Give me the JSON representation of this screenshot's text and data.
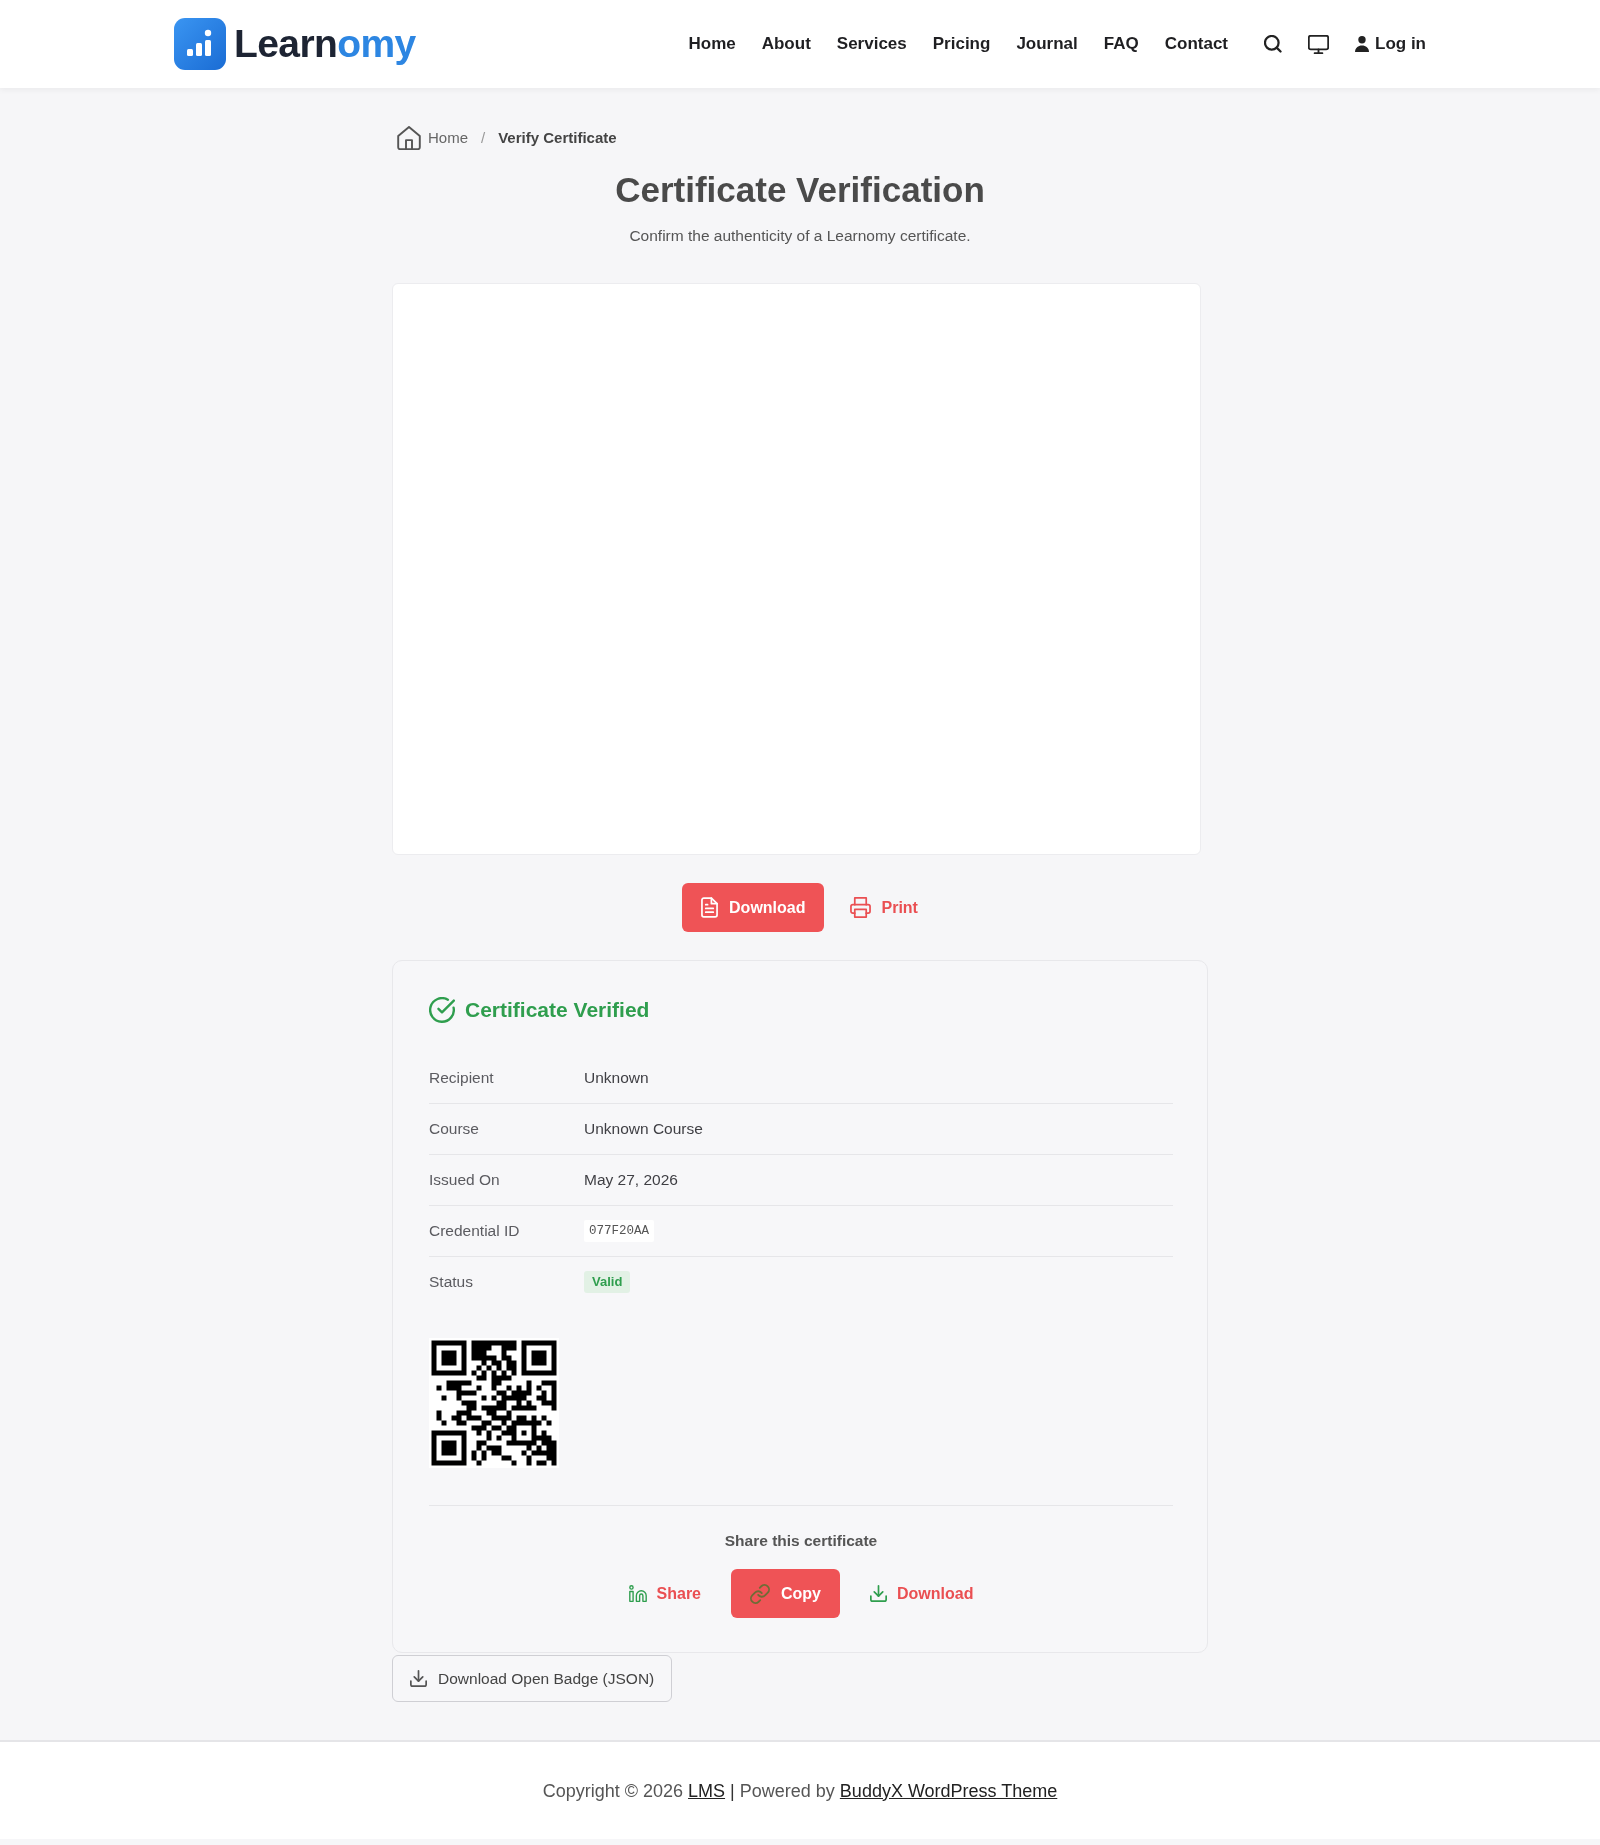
{
  "header": {
    "logo": {
      "main": "Learn",
      "accent": "omy"
    },
    "nav": [
      "Home",
      "About",
      "Services",
      "Pricing",
      "Journal",
      "FAQ",
      "Contact"
    ],
    "login": "Log in"
  },
  "breadcrumb": {
    "separator": "/",
    "items": [
      {
        "label": "Home",
        "kind": "home"
      },
      {
        "label": "Verify Certificate",
        "kind": "current"
      }
    ]
  },
  "title": "Certificate Verification",
  "subtitle": "Confirm the authenticity of a Learnomy certificate.",
  "certificate_actions": [
    {
      "label": "Download",
      "kind": "primary"
    },
    {
      "label": "Print",
      "kind": "plain"
    }
  ],
  "verification": {
    "heading": "Certificate Verified",
    "fields": [
      {
        "label": "Recipient",
        "value": "Unknown",
        "kind": "text"
      },
      {
        "label": "Course",
        "value": "Unknown Course",
        "kind": "text"
      },
      {
        "label": "Issued On",
        "value": "May 27, 2026",
        "kind": "text"
      },
      {
        "label": "Credential ID",
        "value": "077F20AA",
        "kind": "code"
      },
      {
        "label": "Status",
        "value": "Valid",
        "kind": "badge"
      }
    ],
    "share": {
      "heading": "Share this certificate",
      "buttons": [
        {
          "label": "Share",
          "kind": "plain"
        },
        {
          "label": "Copy",
          "kind": "primary"
        },
        {
          "label": "Download",
          "kind": "plain"
        }
      ]
    }
  },
  "open_badge_button": "Download Open Badge (JSON)",
  "footer": {
    "parts": [
      {
        "kind": "text",
        "text": "Copyright © 2026"
      },
      {
        "kind": "link",
        "text": "LMS"
      },
      {
        "kind": "separator",
        "text": "|"
      },
      {
        "kind": "text",
        "text": "Powered by"
      },
      {
        "kind": "link",
        "text": "BuddyX WordPress Theme"
      }
    ]
  }
}
